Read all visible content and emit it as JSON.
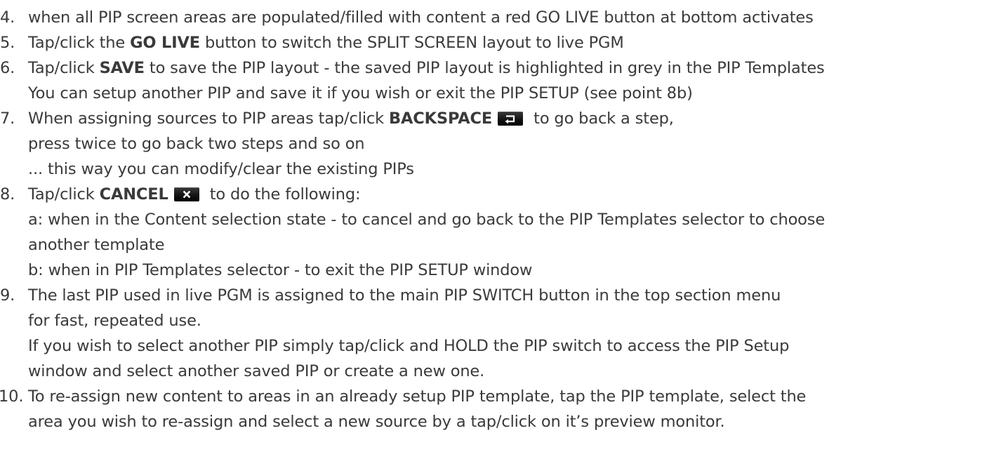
{
  "items": [
    {
      "num": "4.",
      "text": "when all PIP screen areas are populated/filled with content a red GO LIVE button at bottom activates"
    },
    {
      "num": "5.",
      "pre": "Tap/click the ",
      "bold": "GO LIVE",
      "post": " button to switch the SPLIT SCREEN layout to live PGM"
    },
    {
      "num": "6.",
      "pre": "Tap/click ",
      "bold": "SAVE",
      "post": " to save the PIP layout - the saved PIP layout is highlighted in grey in the PIP Templates"
    },
    {
      "cont": "You can setup another PIP and save it if you wish or exit the PIP SETUP (see point 8b)"
    },
    {
      "num": "7.",
      "pre": "When assigning sources to PIP areas tap/click ",
      "bold": "BACKSPACE",
      "icon": "backspace-icon",
      "post": " to go back a step,"
    },
    {
      "cont": "press twice to go back two steps and so on"
    },
    {
      "cont": "... this way you can modify/clear the existing PIPs"
    },
    {
      "num": "8.",
      "pre": "Tap/click ",
      "bold": "CANCEL",
      "icon": "cancel-icon",
      "post": " to do the following:"
    },
    {
      "cont": "a: when in the Content selection state - to cancel and go back to the PIP Templates selector to choose"
    },
    {
      "cont": "another template"
    },
    {
      "cont": "b: when in PIP Templates selector  - to exit the PIP SETUP window"
    },
    {
      "num": "9.",
      "text": "The last PIP used in live PGM is assigned to the main PIP SWITCH button in the top section menu"
    },
    {
      "cont": "for fast, repeated use."
    },
    {
      "cont": "If you wish to select another PIP simply tap/click and HOLD the PIP switch to access the PIP Setup"
    },
    {
      "cont": "window and select another saved PIP or create a new one."
    },
    {
      "num": "10.",
      "text": "To re-assign new content to areas in an already setup PIP template, tap the PIP template, select the"
    },
    {
      "cont": "area you wish to re-assign and select a new source by a tap/click on it’s preview monitor."
    }
  ]
}
